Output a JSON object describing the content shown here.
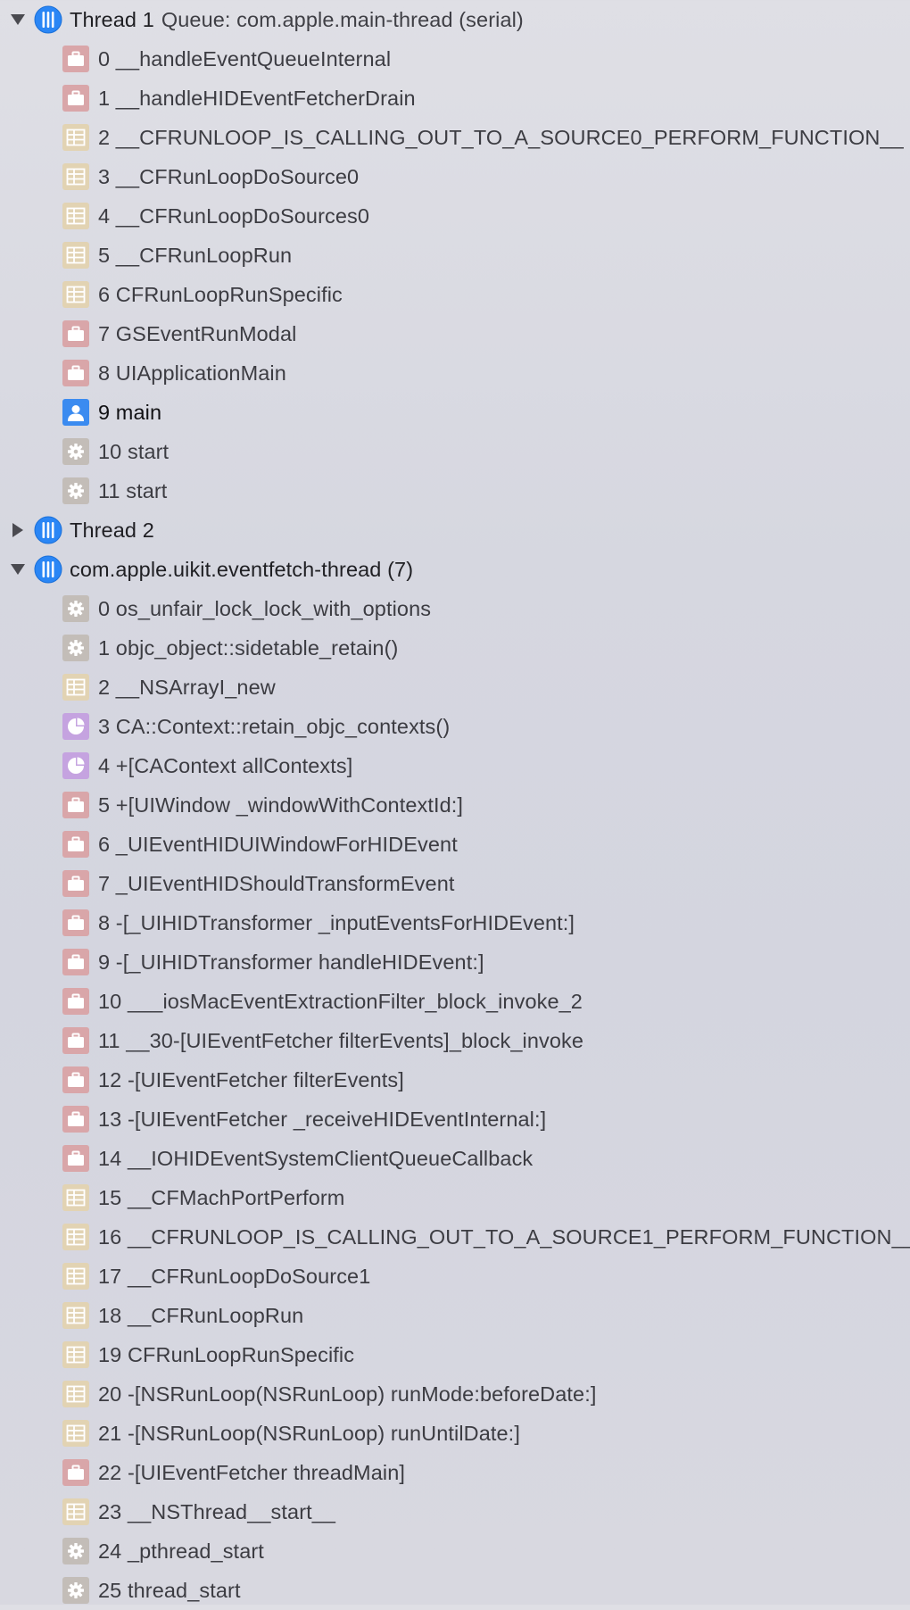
{
  "threads": [
    {
      "title": "Thread 1",
      "subtitle": "Queue: com.apple.main-thread (serial)",
      "expanded": true,
      "frames": [
        {
          "label": "0 __handleEventQueueInternal",
          "icon": "briefcase-icon"
        },
        {
          "label": "1 __handleHIDEventFetcherDrain",
          "icon": "briefcase-icon"
        },
        {
          "label": "2 __CFRUNLOOP_IS_CALLING_OUT_TO_A_SOURCE0_PERFORM_FUNCTION__",
          "icon": "table-icon"
        },
        {
          "label": "3 __CFRunLoopDoSource0",
          "icon": "table-icon"
        },
        {
          "label": "4 __CFRunLoopDoSources0",
          "icon": "table-icon"
        },
        {
          "label": "5 __CFRunLoopRun",
          "icon": "table-icon"
        },
        {
          "label": "6 CFRunLoopRunSpecific",
          "icon": "table-icon"
        },
        {
          "label": "7 GSEventRunModal",
          "icon": "briefcase-icon"
        },
        {
          "label": "8 UIApplicationMain",
          "icon": "briefcase-icon"
        },
        {
          "label": "9 main",
          "icon": "person-icon"
        },
        {
          "label": "10 start",
          "icon": "gear-icon"
        },
        {
          "label": "11 start",
          "icon": "gear-icon"
        }
      ]
    },
    {
      "title": "Thread 2",
      "subtitle": "",
      "expanded": false,
      "frames": []
    },
    {
      "title": "com.apple.uikit.eventfetch-thread (7)",
      "subtitle": "",
      "expanded": true,
      "frames": [
        {
          "label": "0 os_unfair_lock_lock_with_options",
          "icon": "gear-icon"
        },
        {
          "label": "1 objc_object::sidetable_retain()",
          "icon": "gear-icon"
        },
        {
          "label": "2 __NSArrayI_new",
          "icon": "table-icon"
        },
        {
          "label": "3 CA::Context::retain_objc_contexts()",
          "icon": "pie-icon"
        },
        {
          "label": "4 +[CAContext allContexts]",
          "icon": "pie-icon"
        },
        {
          "label": "5 +[UIWindow _windowWithContextId:]",
          "icon": "briefcase-icon"
        },
        {
          "label": "6 _UIEventHIDUIWindowForHIDEvent",
          "icon": "briefcase-icon"
        },
        {
          "label": "7 _UIEventHIDShouldTransformEvent",
          "icon": "briefcase-icon"
        },
        {
          "label": "8 -[_UIHIDTransformer _inputEventsForHIDEvent:]",
          "icon": "briefcase-icon"
        },
        {
          "label": "9 -[_UIHIDTransformer handleHIDEvent:]",
          "icon": "briefcase-icon"
        },
        {
          "label": "10 ___iosMacEventExtractionFilter_block_invoke_2",
          "icon": "briefcase-icon"
        },
        {
          "label": "11 __30-[UIEventFetcher filterEvents]_block_invoke",
          "icon": "briefcase-icon"
        },
        {
          "label": "12 -[UIEventFetcher filterEvents]",
          "icon": "briefcase-icon"
        },
        {
          "label": "13 -[UIEventFetcher _receiveHIDEventInternal:]",
          "icon": "briefcase-icon"
        },
        {
          "label": "14 __IOHIDEventSystemClientQueueCallback",
          "icon": "briefcase-icon"
        },
        {
          "label": "15 __CFMachPortPerform",
          "icon": "table-icon"
        },
        {
          "label": "16 __CFRUNLOOP_IS_CALLING_OUT_TO_A_SOURCE1_PERFORM_FUNCTION__",
          "icon": "table-icon"
        },
        {
          "label": "17 __CFRunLoopDoSource1",
          "icon": "table-icon"
        },
        {
          "label": "18 __CFRunLoopRun",
          "icon": "table-icon"
        },
        {
          "label": "19 CFRunLoopRunSpecific",
          "icon": "table-icon"
        },
        {
          "label": "20 -[NSRunLoop(NSRunLoop) runMode:beforeDate:]",
          "icon": "table-icon"
        },
        {
          "label": "21 -[NSRunLoop(NSRunLoop) runUntilDate:]",
          "icon": "table-icon"
        },
        {
          "label": "22 -[UIEventFetcher threadMain]",
          "icon": "briefcase-icon"
        },
        {
          "label": "23 __NSThread__start__",
          "icon": "table-icon"
        },
        {
          "label": "24 _pthread_start",
          "icon": "gear-icon"
        },
        {
          "label": "25 thread_start",
          "icon": "gear-icon"
        }
      ]
    }
  ]
}
